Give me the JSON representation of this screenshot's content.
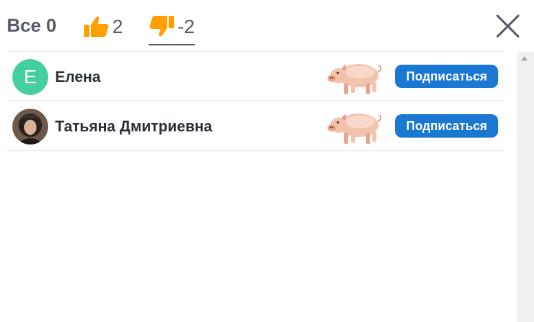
{
  "tabs": {
    "all_label": "Все 0",
    "like_count": "2",
    "dislike_count": "-2",
    "active_tab": "dislike"
  },
  "colors": {
    "accent_orange": "#ffa000",
    "button_blue": "#1a77d2",
    "avatar_green": "#44cfa0",
    "text_gray": "#555b66"
  },
  "icons": {
    "like": "thumbs-up-icon",
    "dislike": "thumbs-down-icon",
    "close": "close-icon",
    "reaction": "pig-emoji-icon"
  },
  "users": [
    {
      "name": "Елена",
      "avatar_letter": "Е",
      "reaction": "pig",
      "button_label": "Подписаться"
    },
    {
      "name": "Татьяна Дмитриевна",
      "avatar_letter": "",
      "reaction": "pig",
      "button_label": "Подписаться"
    }
  ]
}
